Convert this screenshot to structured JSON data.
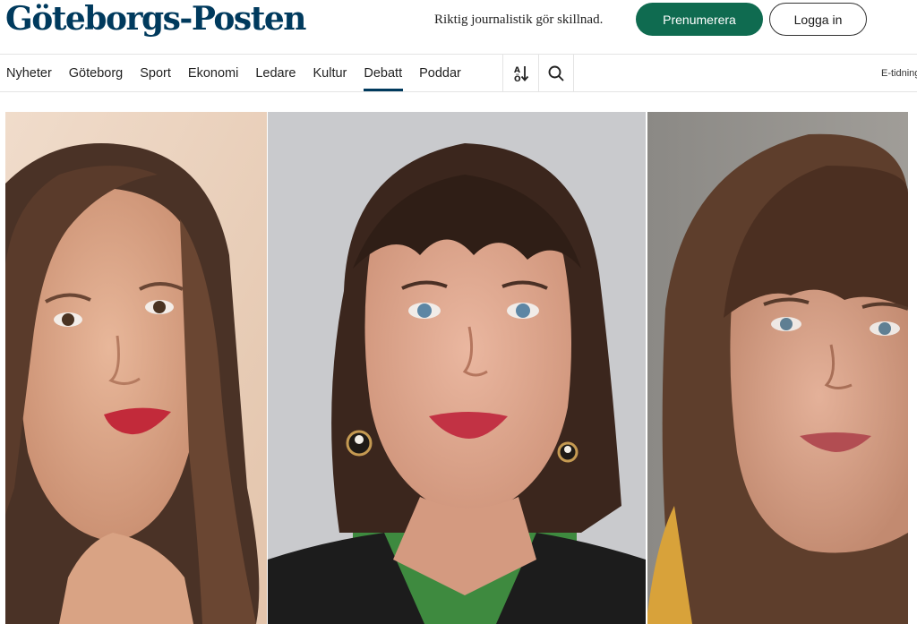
{
  "header": {
    "logo": "Göteborgs-Posten",
    "tagline": "Riktig journalistik gör skillnad.",
    "subscribe_label": "Prenumerera",
    "login_label": "Logga in"
  },
  "nav": {
    "items": [
      {
        "label": "Nyheter"
      },
      {
        "label": "Göteborg"
      },
      {
        "label": "Sport"
      },
      {
        "label": "Ekonomi"
      },
      {
        "label": "Ledare"
      },
      {
        "label": "Kultur"
      },
      {
        "label": "Debatt",
        "active": true
      },
      {
        "label": "Poddar"
      }
    ],
    "sort_icon": "sort-icon",
    "search_icon": "search-icon",
    "etidning_label": "E-tidning"
  },
  "hero": {
    "photos": [
      "portrait-woman-left",
      "portrait-woman-center",
      "portrait-woman-right"
    ]
  },
  "colors": {
    "brand": "#003a5d",
    "subscribe": "#0f6b50"
  }
}
